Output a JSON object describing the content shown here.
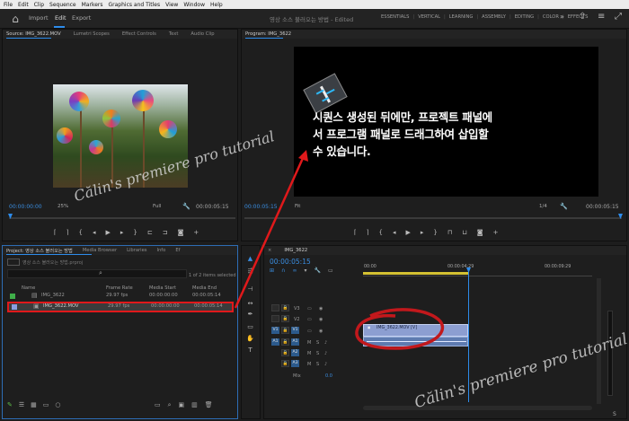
{
  "menu": [
    "File",
    "Edit",
    "Clip",
    "Sequence",
    "Markers",
    "Graphics and Titles",
    "View",
    "Window",
    "Help"
  ],
  "header": {
    "tabs": [
      "Import",
      "Edit",
      "Export"
    ],
    "document_title": "영상 소스 불러오는 방법 - Edited",
    "workspaces": [
      "ESSENTIALS",
      "VERTICAL",
      "LEARNING",
      "ASSEMBLY",
      "EDITING",
      "COLOR",
      "EFFECTS"
    ]
  },
  "source_panel": {
    "tabs": [
      "Source: IMG_3622.MOV",
      "Lumetri Scopes",
      "Effect Controls",
      "Text",
      "Audio Clip"
    ],
    "timecode_left": "00:00:00:00",
    "zoom": "25%",
    "quality": "Full",
    "timecode_right": "00:00:05:15"
  },
  "program_panel": {
    "tab": "Program: IMG_3622",
    "timecode_left": "00:00:05:15",
    "fit": "Fit",
    "ratio": "1/4",
    "timecode_right": "00:00:05:15",
    "overlay_text_lines": [
      "시퀀스 생성된 뒤에만, 프로젝트 패널에",
      "서 프로그램 패널로 드래그하여 삽입할",
      "수 있습니다."
    ]
  },
  "project_panel": {
    "tabs": [
      "Project: 영상 소스 불러오는 방법",
      "Media Browser",
      "Libraries",
      "Info",
      "Ef"
    ],
    "project_file": "영상 소스 불러오는 방법.prproj",
    "item_count": "1 of 2 items selected",
    "columns": [
      "Name",
      "Frame Rate",
      "Media Start",
      "Media End"
    ],
    "rows": [
      {
        "name": "IMG_3622",
        "frame_rate": "29.97 fps",
        "start": "00:00:00:00",
        "end": "00:00:05:14",
        "color": "#3fae49"
      },
      {
        "name": "IMG_3622.MOV",
        "frame_rate": "29.97 fps",
        "start": "00:00:00:00",
        "end": "00:00:05:14",
        "color": "#8a9ee0"
      }
    ]
  },
  "timeline": {
    "tab": "IMG_3622",
    "timecode": "00:00:05:15",
    "ruler": [
      "00:00",
      "00:00:04:29",
      "00:00:09:29"
    ],
    "video_tracks": [
      "V3",
      "V2",
      "V1"
    ],
    "audio_tracks": [
      "A1",
      "A2",
      "A3"
    ],
    "mix": "Mix",
    "mix_value": "0.0",
    "clip_label": "IMG_3622.MOV [V]"
  },
  "watermark": "Călin's premiere pro tutorial",
  "colors": {
    "accent": "#2d8ceb",
    "annotation_red": "#e0191b",
    "panel_bg": "#1e1e1e"
  }
}
